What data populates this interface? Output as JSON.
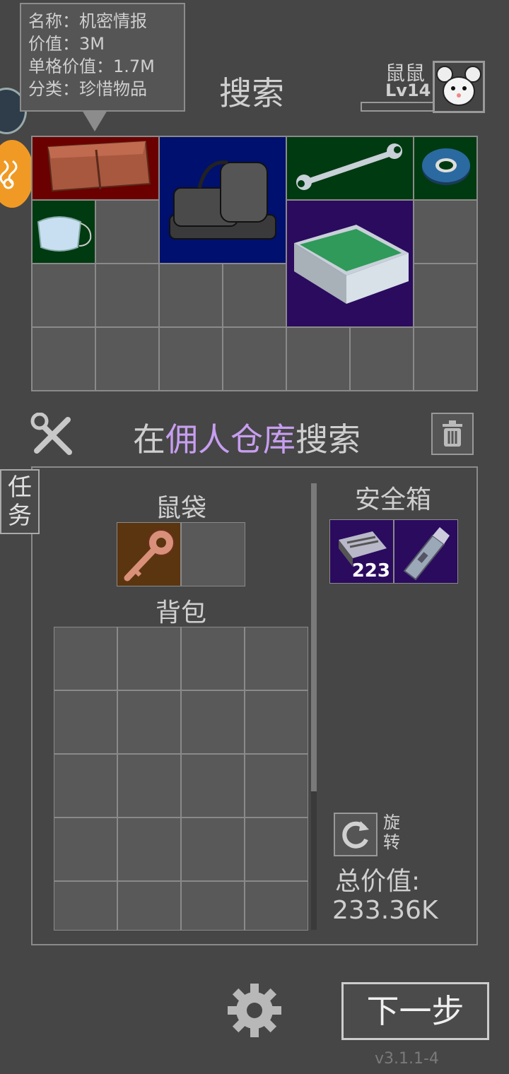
{
  "tooltip": {
    "name_line": "名称：机密情报",
    "value_line": "价值：3M",
    "unit_value_line": "单格价值：1.7M",
    "category_line": "分类：珍惜物品"
  },
  "header": {
    "title": "搜索",
    "player_name": "鼠鼠",
    "player_level": "Lv14"
  },
  "colors": {
    "red_slot": "#6b0000",
    "blue_slot": "#00106e",
    "green_slot": "#003a10",
    "purple_slot": "#2a0b5e",
    "brown_slot": "#5a3510",
    "highlight_text": "#c79ef0"
  },
  "loot": {
    "items": [
      {
        "name": "classified-intel",
        "icon": "folder-icon"
      },
      {
        "name": "backpack-pile",
        "icon": "bags-icon"
      },
      {
        "name": "wrench",
        "icon": "wrench-icon"
      },
      {
        "name": "tape-roll",
        "icon": "tape-icon"
      },
      {
        "name": "face-mask",
        "icon": "mask-icon"
      },
      {
        "name": "glass-panel",
        "icon": "glass-icon"
      }
    ]
  },
  "search_bar": {
    "prefix": "在",
    "location": "佣人仓库",
    "suffix": "搜索"
  },
  "task_button": "任务",
  "inventory": {
    "pouch_label": "鼠袋",
    "backpack_label": "背包",
    "safe_box_label": "安全箱",
    "safe_box_count": "223",
    "rotate_label": "旋转",
    "total_label": "总价值:",
    "total_value": "233.36K"
  },
  "footer": {
    "next_button": "下一步",
    "version": "v3.1.1-4"
  }
}
